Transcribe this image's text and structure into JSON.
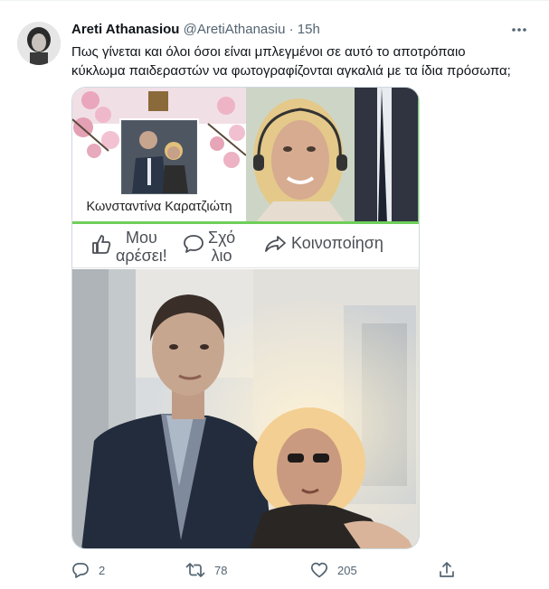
{
  "tweet": {
    "author_name": "Areti Athanasiou",
    "handle": "@AretiAthanasiu",
    "separator": "·",
    "time": "15h",
    "text": "Πως γίνεται και όλοι όσοι είναι μπλεγμένοι σε αυτό το αποτρόπαιο\nκύκλωμα παιδεραστών να φωτογραφίζονται αγκαλιά με τα ίδια πρόσωπα;"
  },
  "media": {
    "profile_name": "Κωνσταντίνα Καρατζιώτη",
    "like_label_line1": "Μου",
    "like_label_line2": "αρέσει!",
    "comment_label_line1": "Σχό",
    "comment_label_line2": "λιο",
    "share_label": "Κοινοποίηση"
  },
  "actions": {
    "replies": "2",
    "retweets": "78",
    "likes": "205"
  },
  "icons": [
    "more-icon",
    "reply-icon",
    "retweet-icon",
    "like-icon",
    "share-icon",
    "fb-like-icon",
    "fb-comment-icon",
    "fb-share-icon"
  ],
  "colors": {
    "text": "#0f1419",
    "secondary": "#536471",
    "border": "#cfd9de",
    "frame_green": "#6fcf5a"
  }
}
